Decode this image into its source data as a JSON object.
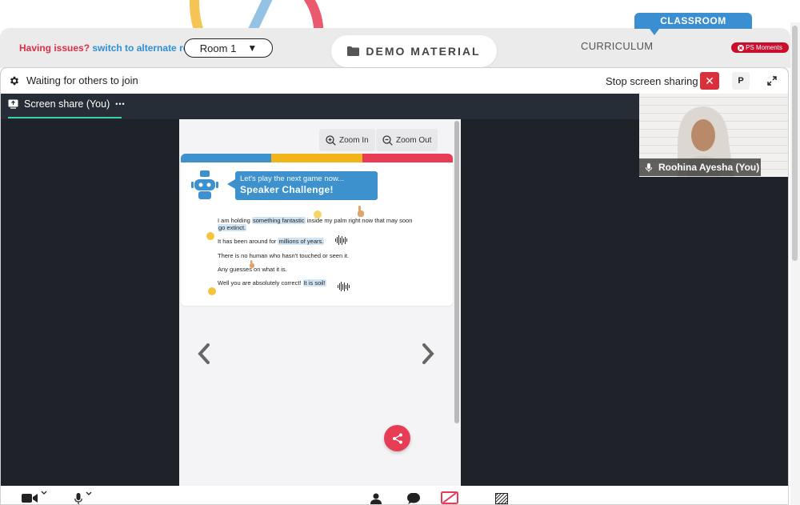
{
  "header": {
    "issues_prefix": "Having issues?",
    "issues_link": "switch to alternate room",
    "room_select": {
      "value": "Room 1",
      "caret": "▼"
    },
    "demo_material": "DEMO MATERIAL",
    "curriculum": "CURRICULUM",
    "classroom": "CLASSROOM",
    "ps_moments": "PS Moments"
  },
  "meeting": {
    "status": "Waiting for others to join",
    "stop_sharing": "Stop screen sharing",
    "close_icon": "✕",
    "p_label": "P",
    "share_tab_label": "Screen share (You)",
    "share_tab_more": "•••"
  },
  "participant": {
    "name": "Roohina Ayesha (You)"
  },
  "slide": {
    "zoom_in": "Zoom In",
    "zoom_out": "Zoom Out",
    "bubble_line1": "Let's play the next game now...",
    "bubble_line2": "Speaker Challenge!",
    "lines": {
      "l1a": "I am holding ",
      "l1b": "something fantastic",
      "l1c": " inside my palm right now that may soon",
      "l1d": "go extinct.",
      "l2a": "It has been around for ",
      "l2b": "millions of years.",
      "l3": "There is no human who hasn't touched or seen it.",
      "l4": "Any guesses on what it is.",
      "l5a": "Well you are absolutely correct! ",
      "l5b": "It is soil!"
    }
  },
  "colors": {
    "accent_blue": "#3b8fd0",
    "alert_red": "#d9303c",
    "stripe_blue": "#3d92ce",
    "stripe_yellow": "#f1b51b",
    "stripe_red": "#e63d55",
    "share_underline": "#3ad29f"
  },
  "icons": [
    "folder-icon",
    "gear-icon",
    "close-icon",
    "expand-icon",
    "screen-share-icon",
    "mic-icon",
    "zoom-in-icon",
    "zoom-out-icon",
    "robot-icon",
    "chevron-left-icon",
    "chevron-right-icon",
    "share-icon",
    "camera-icon",
    "person-icon",
    "chat-icon",
    "screen-share-stop-icon",
    "whiteboard-icon"
  ]
}
